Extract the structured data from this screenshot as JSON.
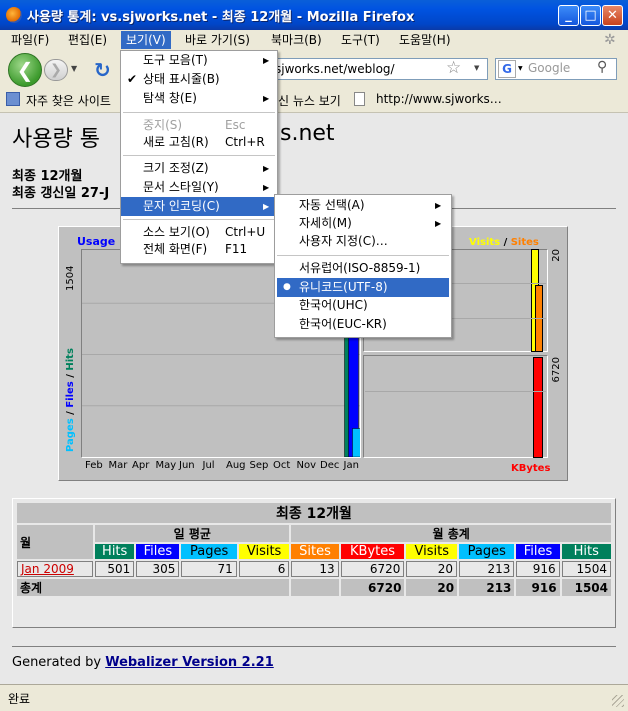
{
  "window": {
    "title": "사용량 통계: vs.sjworks.net - 최종 12개월 - Mozilla Firefox"
  },
  "menubar": [
    "파일(F)",
    "편집(E)",
    "보기(V)",
    "바로 가기(S)",
    "북마크(B)",
    "도구(T)",
    "도움말(H)"
  ],
  "nav": {
    "url": "sjworks.net/weblog/",
    "search_placeholder": "Google"
  },
  "bookmarks": {
    "frequent": "자주 찾은 사이트",
    "latest_news": "신 뉴스 보기",
    "link": "http://www.sjworks…"
  },
  "view_menu": {
    "toolbars": "도구 모음(T)",
    "status_bar": "상태 표시줄(B)",
    "sidebar": "탐색 창(E)",
    "stop": "중지(S)",
    "stop_key": "Esc",
    "reload": "새로 고침(R)",
    "reload_key": "Ctrl+R",
    "zoom": "크기 조정(Z)",
    "page_style": "문서 스타일(Y)",
    "encoding": "문자 인코딩(C)",
    "source": "소스 보기(O)",
    "source_key": "Ctrl+U",
    "fullscreen": "전체 화면(F)",
    "fullscreen_key": "F11"
  },
  "encoding_menu": {
    "auto": "자동 선택(A)",
    "more": "자세히(M)",
    "custom": "사용자 지정(C)…",
    "western": "서유럽어(ISO-8859-1)",
    "utf8": "유니코드(UTF-8)",
    "korean_uhc": "한국어(UHC)",
    "korean_euckr": "한국어(EUC-KR)"
  },
  "page": {
    "heading_left": "사용량 통",
    "heading_right": "s.net",
    "period": "최종 12개월",
    "updated": "최종 갱신일 27-J",
    "footer_prefix": "Generated by ",
    "footer_link": "Webalizer Version 2.21"
  },
  "chart": {
    "usage_label": "Usage",
    "left_max": "1504",
    "left_axis": {
      "pages": "Pages",
      "sep1": " / ",
      "files": "Files",
      "sep2": " / ",
      "hits": "Hits"
    },
    "right_title": {
      "visits": "Visits",
      "sep": " / ",
      "sites": "Sites"
    },
    "right_top_max": "20",
    "right_bottom_max": "6720",
    "kbytes": "KBytes",
    "months": [
      "Feb",
      "Mar",
      "Apr",
      "May",
      "Jun",
      "Jul",
      "Aug",
      "Sep",
      "Oct",
      "Nov",
      "Dec",
      "Jan"
    ]
  },
  "chart_data": {
    "type": "bar",
    "categories": [
      "Feb",
      "Mar",
      "Apr",
      "May",
      "Jun",
      "Jul",
      "Aug",
      "Sep",
      "Oct",
      "Nov",
      "Dec",
      "Jan"
    ],
    "series": [
      {
        "name": "Hits",
        "values": [
          0,
          0,
          0,
          0,
          0,
          0,
          0,
          0,
          0,
          0,
          0,
          1504
        ]
      },
      {
        "name": "Files",
        "values": [
          0,
          0,
          0,
          0,
          0,
          0,
          0,
          0,
          0,
          0,
          0,
          916
        ]
      },
      {
        "name": "Pages",
        "values": [
          0,
          0,
          0,
          0,
          0,
          0,
          0,
          0,
          0,
          0,
          0,
          213
        ]
      },
      {
        "name": "Visits",
        "values": [
          20
        ]
      },
      {
        "name": "Sites",
        "values": [
          13
        ]
      },
      {
        "name": "KBytes",
        "values": [
          6720
        ]
      }
    ]
  },
  "table": {
    "title": "최종 12개월",
    "month_header": "월",
    "daily_avg": "일 평균",
    "monthly_total": "월 총계",
    "cols": [
      "Hits",
      "Files",
      "Pages",
      "Visits",
      "Sites",
      "KBytes",
      "Visits",
      "Pages",
      "Files",
      "Hits"
    ],
    "rows": [
      {
        "month": "Jan 2009",
        "values": [
          "501",
          "305",
          "71",
          "6",
          "13",
          "6720",
          "20",
          "213",
          "916",
          "1504"
        ]
      }
    ],
    "total_label": "총계",
    "totals": [
      "6720",
      "20",
      "213",
      "916",
      "1504"
    ]
  },
  "status": "완료",
  "colors": {
    "hits": "#00805c",
    "files": "#0000ff",
    "pages": "#00c0ff",
    "visits": "#ffff00",
    "sites": "#ff8000",
    "kbytes": "#ff0000"
  }
}
